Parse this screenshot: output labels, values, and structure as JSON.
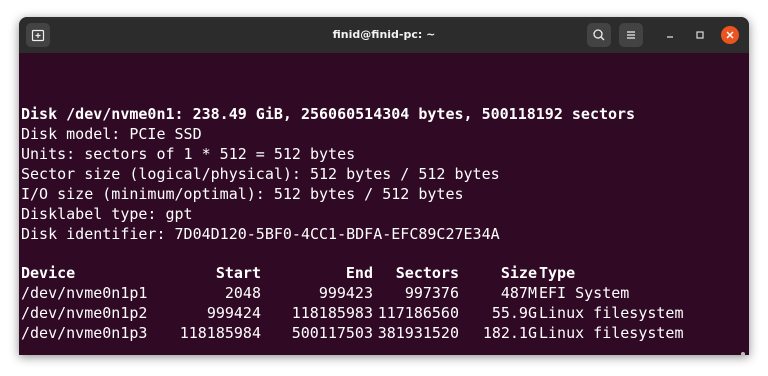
{
  "window": {
    "title": "finid@finid-pc: ~"
  },
  "icons": {
    "new_tab": "new-tab-icon",
    "search": "search-icon",
    "menu": "hamburger-menu-icon",
    "minimize": "minimize-icon",
    "maximize": "maximize-icon",
    "close": "close-icon"
  },
  "colors": {
    "terminal_bg": "#300a24",
    "titlebar_bg": "#2c2c2c",
    "text": "#ffffff",
    "close_button": "#e95420"
  },
  "terminal": {
    "disk_header": "Disk /dev/nvme0n1: 238.49 GiB, 256060514304 bytes, 500118192 sectors",
    "info_lines": [
      "Disk model: PCIe SSD",
      "Units: sectors of 1 * 512 = 512 bytes",
      "Sector size (logical/physical): 512 bytes / 512 bytes",
      "I/O size (minimum/optimal): 512 bytes / 512 bytes",
      "Disklabel type: gpt",
      "Disk identifier: 7D04D120-5BF0-4CC1-BDFA-EFC89C27E34A"
    ],
    "table": {
      "headers": {
        "device": "Device",
        "start": "Start",
        "end": "End",
        "sectors": "Sectors",
        "size": "Size",
        "type": "Type"
      },
      "rows": [
        {
          "device": "/dev/nvme0n1p1",
          "start": "2048",
          "end": "999423",
          "sectors": "997376",
          "size": "487M",
          "type": "EFI System"
        },
        {
          "device": "/dev/nvme0n1p2",
          "start": "999424",
          "end": "118185983",
          "sectors": "117186560",
          "size": "55.9G",
          "type": "Linux filesystem"
        },
        {
          "device": "/dev/nvme0n1p3",
          "start": "118185984",
          "end": "500117503",
          "sectors": "381931520",
          "size": "182.1G",
          "type": "Linux filesystem"
        }
      ]
    }
  }
}
